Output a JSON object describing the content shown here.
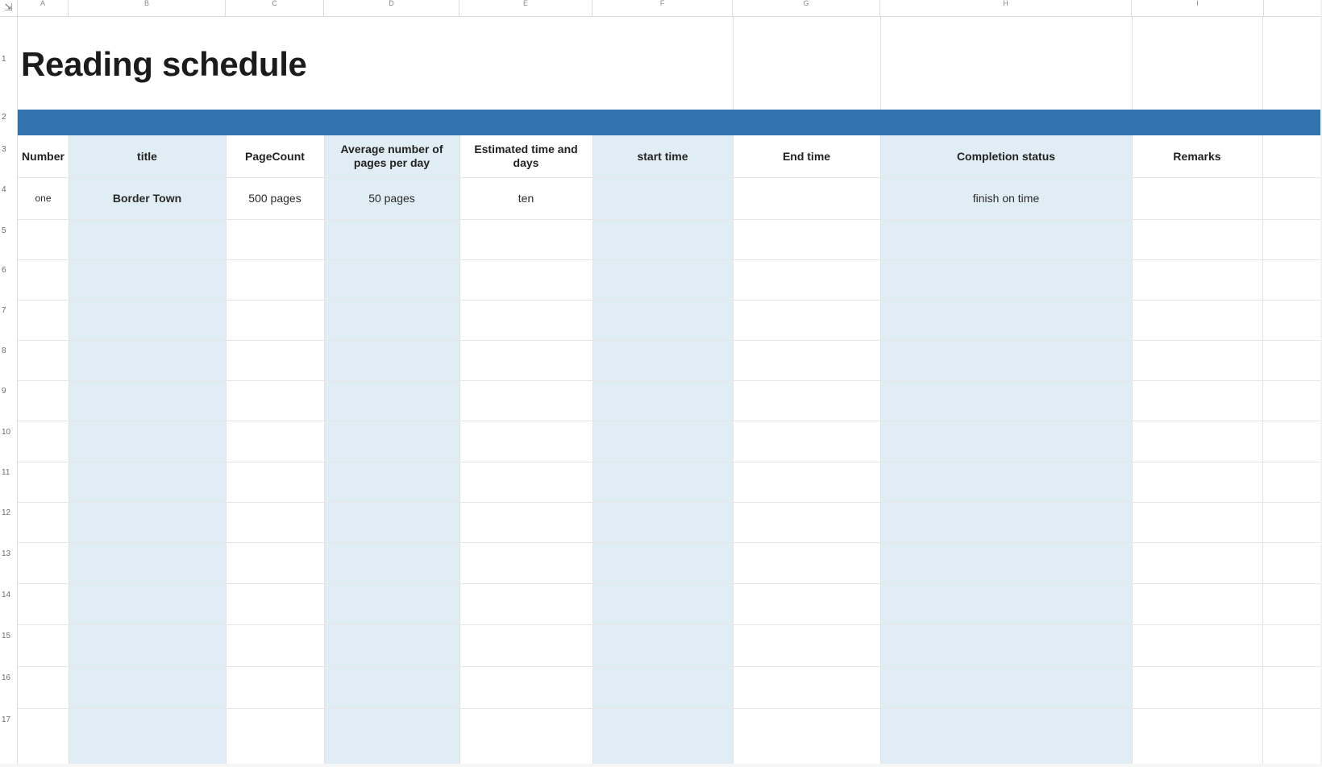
{
  "sheet": {
    "title": "Reading schedule",
    "corner_icon": "freeze-panes-icon",
    "accent_color": "#3273ad",
    "band_color": "#e0edf4",
    "column_letters": [
      "A",
      "B",
      "C",
      "D",
      "E",
      "F",
      "G",
      "H",
      "I"
    ],
    "row_numbers": [
      "1",
      "2",
      "3",
      "4",
      "5",
      "6",
      "7",
      "8",
      "9",
      "10",
      "11",
      "12",
      "13",
      "14",
      "15",
      "16",
      "17"
    ],
    "headers": {
      "number": "Number",
      "title": "title",
      "page_count": "PageCount",
      "avg_pages": "Average number of pages per day",
      "estimated": "Estimated time and days",
      "start": "start time",
      "end": "End time",
      "status": "Completion status",
      "remarks": "Remarks"
    },
    "row4": {
      "number": "one",
      "title": "Border Town",
      "page_count": "500 pages",
      "avg_pages": "50 pages",
      "estimated": "ten",
      "start": "",
      "end": "",
      "status": "finish on time",
      "remarks": ""
    }
  }
}
